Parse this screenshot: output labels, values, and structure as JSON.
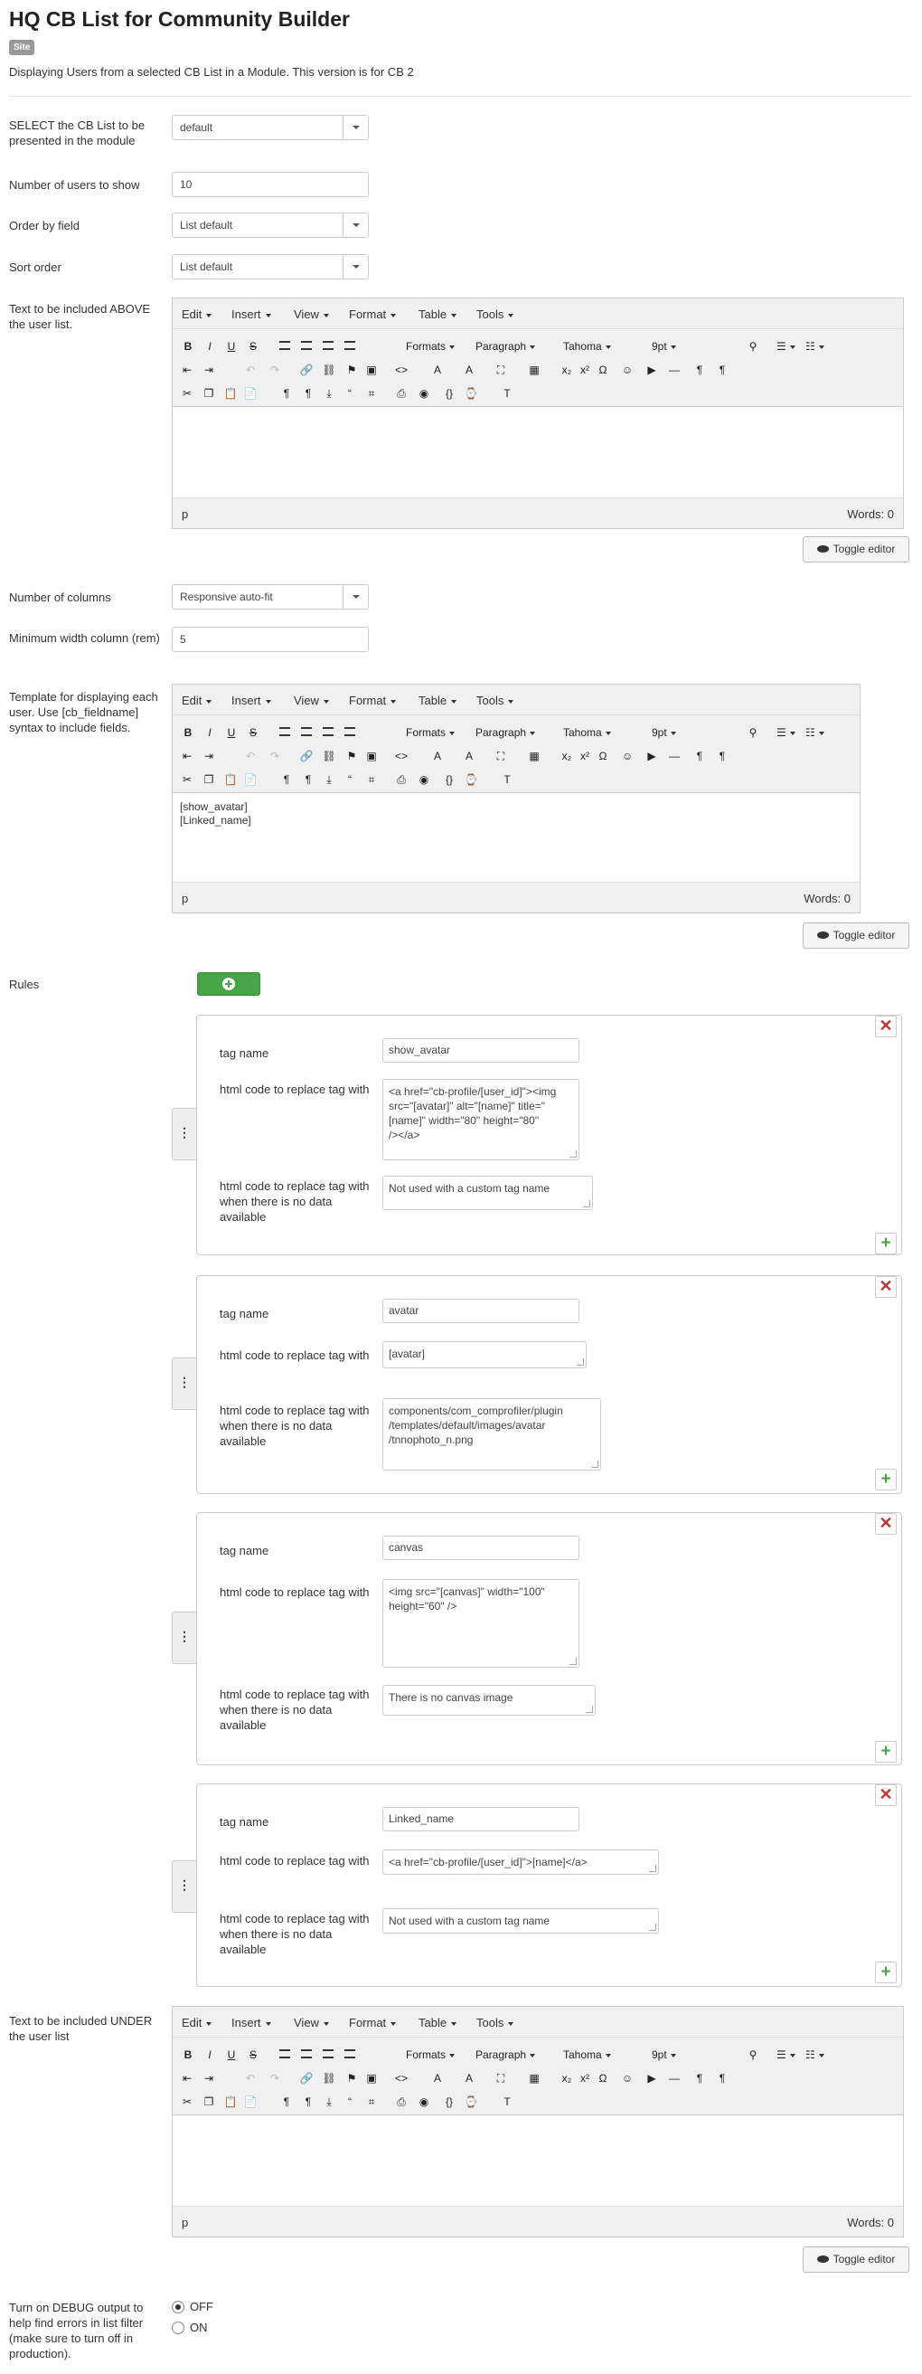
{
  "header": {
    "title": "HQ CB List for Community Builder",
    "badge": "Site",
    "description": "Displaying Users from a selected CB List in a Module. This version is for CB 2"
  },
  "fields": {
    "cb_list": {
      "label": "SELECT the CB List to be presented in the module",
      "value": "default"
    },
    "num_users": {
      "label": "Number of users to show",
      "value": "10"
    },
    "order_by": {
      "label": "Order by field",
      "value": "List default"
    },
    "sort_order": {
      "label": "Sort order",
      "value": "List default"
    },
    "text_above": {
      "label": "Text to be included ABOVE the user list."
    },
    "num_columns": {
      "label": "Number of columns",
      "value": "Responsive auto-fit"
    },
    "min_width": {
      "label": "Minimum width column (rem)",
      "value": "5"
    },
    "template": {
      "label": "Template for displaying each user. Use [cb_fieldname] syntax to include fields.",
      "content_line1": "[show_avatar]",
      "content_line2": "[Linked_name]"
    },
    "text_under": {
      "label": "Text to be included UNDER the user list"
    },
    "rules": {
      "label": "Rules"
    },
    "debug": {
      "label": "Turn on DEBUG output to help find errors in list filter (make sure to turn off in production).",
      "options": [
        "OFF",
        "ON"
      ],
      "selected": "OFF"
    }
  },
  "editor": {
    "menus": [
      "Edit",
      "Insert",
      "View",
      "Format",
      "Table",
      "Tools"
    ],
    "formats_label": "Formats",
    "block_label": "Paragraph",
    "font_label": "Tahoma",
    "size_label": "9pt",
    "status_path": "p",
    "words": "Words: 0",
    "toggle_label": "Toggle editor",
    "icons": {
      "bold": "B",
      "italic": "I",
      "underline": "U",
      "strike": "S",
      "omega": "Ω",
      "subscript": "x₂",
      "superscript": "x²",
      "code": "<>",
      "braces": "{;}",
      "clear": "Tx",
      "pilcrow": "¶",
      "quote": "66"
    }
  },
  "rules": {
    "tag_name_label": "tag name",
    "replace_label": "html code to replace tag with",
    "nodata_label": "html code to replace tag with when there is no data available",
    "items": [
      {
        "tag": "show_avatar",
        "html_l1": "<a href=\"cb-profile/[user_id]\"><img",
        "html_l2": "src=\"[avatar]\" alt=\"[name]\" title=\"",
        "html_l3": "[name]\" width=\"80\" height=\"80\"",
        "html_l4": "/></a>",
        "nodata": "Not used with a custom tag name"
      },
      {
        "tag": "avatar",
        "html_l1": "[avatar]",
        "nodata_l1": "components/com_comprofiler/plugin",
        "nodata_l2": "/templates/default/images/avatar",
        "nodata_l3": "/tnnophoto_n.png"
      },
      {
        "tag": "canvas",
        "html_l1": "<img src=\"[canvas]\" width=\"100\"",
        "html_l2": "height=\"60\" />",
        "nodata": "There is no canvas image"
      },
      {
        "tag": "Linked_name",
        "html_l1": "<a href=\"cb-profile/[user_id]\">[name]</a>",
        "nodata": "Not used with a custom tag name"
      }
    ]
  },
  "colors": {
    "add_button": "#46a546",
    "remove_icon": "#bd362f"
  }
}
